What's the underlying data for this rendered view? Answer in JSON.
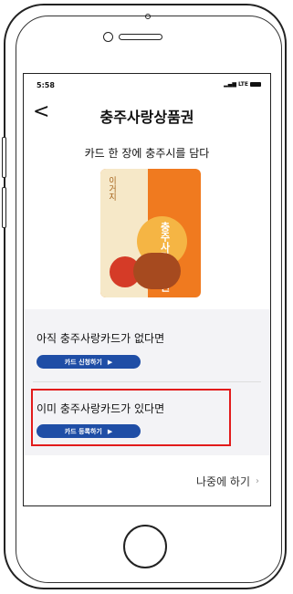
{
  "status_bar": {
    "time": "5:58",
    "network": "LTE"
  },
  "header": {
    "back_icon": "chevron-left-icon",
    "title": "충주사랑상품권"
  },
  "subtitle": "카드 한 장에 충주시를 담다",
  "card": {
    "side_text": "이거지",
    "main_text": "충주사랑상품권"
  },
  "sections": {
    "apply": {
      "title": "아직 충주사랑카드가 없다면",
      "button": "카드 신청하기",
      "arrow": "▶"
    },
    "register": {
      "title": "이미 충주사랑카드가 있다면",
      "button": "카드 등록하기",
      "arrow": "▶"
    }
  },
  "later": {
    "label": "나중에 하기",
    "chevron": "›"
  },
  "colors": {
    "button_blue": "#1f4ea6",
    "highlight_red": "#e21b1b",
    "card_orange": "#f07a1f"
  }
}
